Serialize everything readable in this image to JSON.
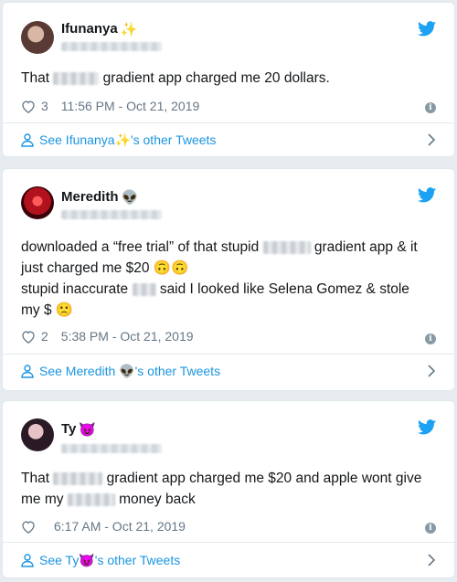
{
  "tweets": [
    {
      "name": "Ifunanya",
      "name_emoji": "✨",
      "text_parts": [
        "That",
        "gradient app charged me 20 dollars."
      ],
      "likes": "3",
      "time": "11:56 PM - Oct 21, 2019",
      "footer_prefix": "See Ifunanya",
      "footer_emoji": "✨",
      "footer_suffix": "'s other Tweets"
    },
    {
      "name": "Meredith",
      "name_emoji": "👽",
      "line1_a": "downloaded a “free trial” of that stupid",
      "line1_b": "gradient app & it",
      "line2": "just charged me $20",
      "line2_emoji": "🙃🙃",
      "line3_a": "stupid inaccurate",
      "line3_b": "said I looked like Selena Gomez & stole",
      "line4": "my $",
      "line4_emoji": "🙁",
      "likes": "2",
      "time": "5:38 PM - Oct 21, 2019",
      "footer_prefix": "See Meredith",
      "footer_emoji": "👽",
      "footer_suffix": "'s other Tweets"
    },
    {
      "name": "Ty",
      "name_emoji": "😈",
      "line1_a": "That",
      "line1_b": "gradient app charged me $20 and apple wont give",
      "line2_a": "me my",
      "line2_b": "money back",
      "time": "6:17 AM - Oct 21, 2019",
      "footer_prefix": "See Ty",
      "footer_emoji": "😈",
      "footer_suffix": "'s other Tweets"
    }
  ],
  "icons": {
    "bird": "twitter-bird-icon",
    "heart": "heart-icon",
    "info": "info-icon",
    "person": "person-icon",
    "chevron": "chevron-right-icon"
  },
  "colors": {
    "brand": "#1da1f2",
    "link": "#1b95e0",
    "muted": "#657786"
  },
  "info_glyph": "i"
}
